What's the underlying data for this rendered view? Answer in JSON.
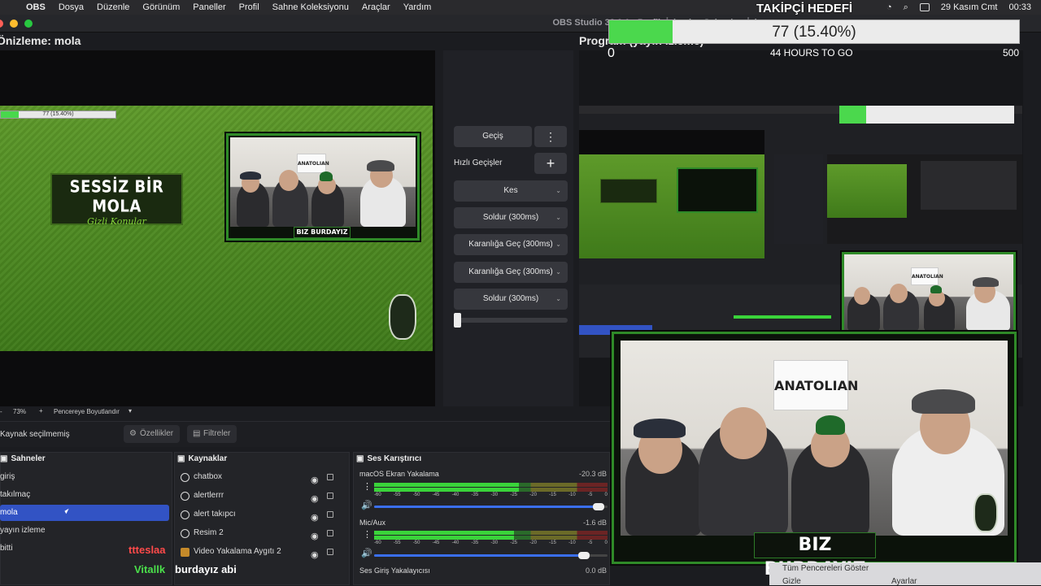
{
  "menubar": {
    "apple": "",
    "items": [
      "OBS",
      "Dosya",
      "Düzenle",
      "Görünüm",
      "Paneller",
      "Profil",
      "Sahne Koleksiyonu",
      "Araçlar",
      "Yardım"
    ],
    "date": "29 Kasım Cmt",
    "time": "00:33"
  },
  "window": {
    "title": "OBS Studio 32.0.1 - Profil: İsimsiz - Sahneler: İsim"
  },
  "preview": {
    "label": "Önizleme: mola",
    "zoom": "73%",
    "zoom_plus": "+",
    "fit_label": "Pencereye Boyutlandır"
  },
  "program": {
    "label": "Program (yayın izleme)"
  },
  "follower_goal": {
    "header": "TAKİPÇİ HEDEFİ",
    "value_text": "77 (15.40%)",
    "progress_percent": 15.4,
    "min": "0",
    "max": "500",
    "remaining": "44 HOURS TO GO"
  },
  "overlay": {
    "title_line1": "SESSİZ BİR MOLA",
    "title_line2": "Gizli Konular",
    "cam_banner": "BIZ BURDAYIZ",
    "sign_text": "ANATOLIAN"
  },
  "transitions": {
    "main": "Geçiş",
    "quick_label": "Hızlı Geçişler",
    "add": "+",
    "items": [
      "Kes",
      "Soldur (300ms)",
      "Karanlığa Geç (300ms)",
      "Karanlığa Geç (300ms)",
      "Soldur (300ms)"
    ]
  },
  "props_bar": {
    "status": "Kaynak seçilmemiş",
    "properties": "Özellikler",
    "filters": "Filtreler"
  },
  "scenes": {
    "title": "Sahneler",
    "items": [
      "giriş",
      "takılmaç",
      "mola",
      "yayın izleme",
      "bitti"
    ],
    "selected_index": 2
  },
  "sources": {
    "title": "Kaynaklar",
    "items": [
      "chatbox",
      "alertlerrr",
      "alert takıpcı",
      "Resim 2",
      "Video Yakalama Aygıtı 2"
    ]
  },
  "mixer": {
    "title": "Ses Karıştırıcı",
    "channels": [
      {
        "name": "macOS Ekran Yakalama",
        "db": "-20.3 dB",
        "level": 0.62,
        "volume": 0.96
      },
      {
        "name": "Mic/Aux",
        "db": "-1.6 dB",
        "level": 0.6,
        "volume": 0.9
      },
      {
        "name": "Ses Giriş Yakalayıcısı",
        "db": "0.0 dB"
      }
    ],
    "scale": [
      "-60",
      "-55",
      "-50",
      "-45",
      "-40",
      "-35",
      "-30",
      "-25",
      "-20",
      "-15",
      "-10",
      "-5",
      "0"
    ]
  },
  "chat": [
    {
      "user": "ttteslaa",
      "message": "",
      "color": "#ff4a4a"
    },
    {
      "user": "Vitallk",
      "message": "burdayız abi",
      "color": "#4be04b"
    }
  ],
  "context_menu": {
    "item1": "Tüm Pencereleri Göster",
    "item2": "Gizle",
    "settings": "Ayarlar"
  },
  "colors": {
    "accent_selected": "#3253c4",
    "goal_fill": "#4bd84d",
    "cam_border": "#2f8a28"
  }
}
